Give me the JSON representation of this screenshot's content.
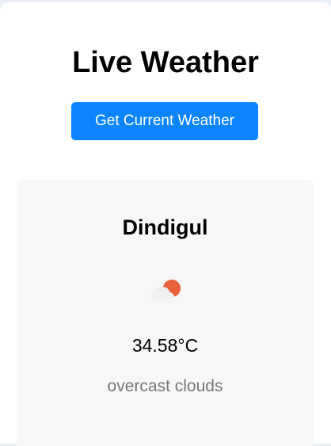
{
  "header": {
    "title": "Live Weather"
  },
  "actions": {
    "get_weather_label": "Get Current Weather"
  },
  "weather": {
    "city": "Dindigul",
    "icon": "overcast-clouds-icon",
    "temperature": "34.58°C",
    "description": "overcast clouds"
  },
  "colors": {
    "button": "#0a84ff",
    "card_background": "#f7f7f7",
    "sun": "#e8603c"
  }
}
